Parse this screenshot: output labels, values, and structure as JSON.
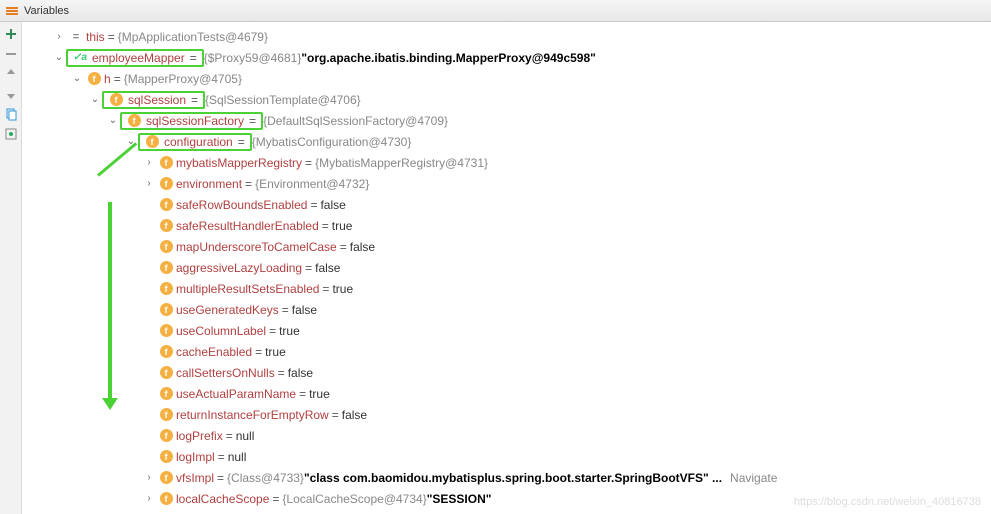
{
  "title": "Variables",
  "sidebar_tooltips": [
    "add",
    "minus",
    "up",
    "down",
    "paste",
    "watches"
  ],
  "tree": [
    {
      "depth": 0,
      "toggle": "collapsed",
      "icon": "eq",
      "name": "this",
      "value": "{MpApplicationTests@4679}",
      "hl": false
    },
    {
      "depth": 0,
      "toggle": "expanded",
      "icon": "check",
      "name": "employeeMapper",
      "value": "{$Proxy59@4681}",
      "extra": "\"org.apache.ibatis.binding.MapperProxy@949c598\"",
      "hl": true,
      "hlTop": true
    },
    {
      "depth": 1,
      "toggle": "expanded",
      "icon": "field",
      "name": "h",
      "value": "{MapperProxy@4705}",
      "hl": false
    },
    {
      "depth": 2,
      "toggle": "expanded",
      "icon": "field",
      "name": "sqlSession",
      "value": "{SqlSessionTemplate@4706}",
      "hl": true
    },
    {
      "depth": 3,
      "toggle": "expanded",
      "icon": "field",
      "name": "sqlSessionFactory",
      "value": "{DefaultSqlSessionFactory@4709}",
      "hl": true
    },
    {
      "depth": 4,
      "toggle": "expanded",
      "icon": "field",
      "name": "configuration",
      "value": "{MybatisConfiguration@4730}",
      "hl": true
    },
    {
      "depth": 5,
      "toggle": "collapsed",
      "icon": "field",
      "name": "mybatisMapperRegistry",
      "value": "{MybatisMapperRegistry@4731}"
    },
    {
      "depth": 5,
      "toggle": "collapsed",
      "icon": "field",
      "name": "environment",
      "value": "{Environment@4732}"
    },
    {
      "depth": 5,
      "toggle": "none",
      "icon": "field",
      "name": "safeRowBoundsEnabled",
      "value": "false",
      "plain": true
    },
    {
      "depth": 5,
      "toggle": "none",
      "icon": "field",
      "name": "safeResultHandlerEnabled",
      "value": "true",
      "plain": true
    },
    {
      "depth": 5,
      "toggle": "none",
      "icon": "field",
      "name": "mapUnderscoreToCamelCase",
      "value": "false",
      "plain": true
    },
    {
      "depth": 5,
      "toggle": "none",
      "icon": "field",
      "name": "aggressiveLazyLoading",
      "value": "false",
      "plain": true
    },
    {
      "depth": 5,
      "toggle": "none",
      "icon": "field",
      "name": "multipleResultSetsEnabled",
      "value": "true",
      "plain": true
    },
    {
      "depth": 5,
      "toggle": "none",
      "icon": "field",
      "name": "useGeneratedKeys",
      "value": "false",
      "plain": true
    },
    {
      "depth": 5,
      "toggle": "none",
      "icon": "field",
      "name": "useColumnLabel",
      "value": "true",
      "plain": true
    },
    {
      "depth": 5,
      "toggle": "none",
      "icon": "field",
      "name": "cacheEnabled",
      "value": "true",
      "plain": true
    },
    {
      "depth": 5,
      "toggle": "none",
      "icon": "field",
      "name": "callSettersOnNulls",
      "value": "false",
      "plain": true
    },
    {
      "depth": 5,
      "toggle": "none",
      "icon": "field",
      "name": "useActualParamName",
      "value": "true",
      "plain": true
    },
    {
      "depth": 5,
      "toggle": "none",
      "icon": "field",
      "name": "returnInstanceForEmptyRow",
      "value": "false",
      "plain": true
    },
    {
      "depth": 5,
      "toggle": "none",
      "icon": "field",
      "name": "logPrefix",
      "value": "null",
      "plain": true
    },
    {
      "depth": 5,
      "toggle": "none",
      "icon": "field",
      "name": "logImpl",
      "value": "null",
      "plain": true
    },
    {
      "depth": 5,
      "toggle": "collapsed",
      "icon": "field",
      "name": "vfsImpl",
      "value": "{Class@4733}",
      "extra": "\"class com.baomidou.mybatisplus.spring.boot.starter.SpringBootVFS\" ...",
      "nav": "Navigate"
    },
    {
      "depth": 5,
      "toggle": "collapsed",
      "icon": "field",
      "name": "localCacheScope",
      "value": "{LocalCacheScope@4734}",
      "extra": "\"SESSION\""
    }
  ],
  "watermark": "https://blog.csdn.net/weixin_40816738"
}
